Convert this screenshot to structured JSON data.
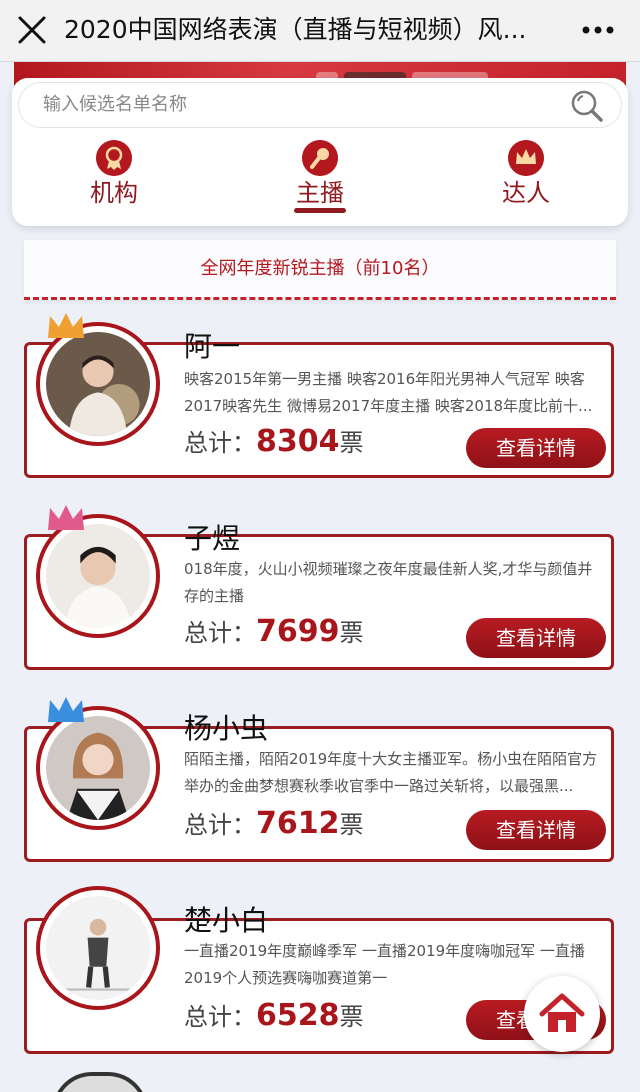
{
  "titlebar": {
    "title": "2020中国网络表演（直播与短视频）风..."
  },
  "search": {
    "placeholder": "输入候选名单名称"
  },
  "tabs": [
    {
      "label": "机构",
      "icon": "medal-icon",
      "active": false
    },
    {
      "label": "主播",
      "icon": "microphone-icon",
      "active": true
    },
    {
      "label": "达人",
      "icon": "crown-icon",
      "active": false
    }
  ],
  "ranking_title": "全网年度新锐主播（前10名）",
  "candidates": [
    {
      "rank": 1,
      "name": "阿一",
      "desc": "映客2015年第一男主播 映客2016年阳光男神人气冠军 映客2017映客先生 微博易2017年度主播 映客2018年度比前十...",
      "total_label": "总计：",
      "votes": "8304",
      "unit": "票",
      "button": "查看详情"
    },
    {
      "rank": 2,
      "name": "子煜",
      "desc": "018年度，火山小视频璀璨之夜年度最佳新人奖,才华与颜值并存的主播",
      "total_label": "总计：",
      "votes": "7699",
      "unit": "票",
      "button": "查看详情"
    },
    {
      "rank": 3,
      "name": "杨小虫",
      "desc": "陌陌主播，陌陌2019年度十大女主播亚军。杨小虫在陌陌官方举办的金曲梦想赛秋季收官季中一路过关斩将，以最强黑...",
      "total_label": "总计：",
      "votes": "7612",
      "unit": "票",
      "button": "查看详情"
    },
    {
      "rank": 4,
      "name": "楚小白",
      "desc": "一直播2019年度巅峰季军 一直播2019年度嗨咖冠军 一直播2019个人预选赛嗨咖赛道第一",
      "total_label": "总计：",
      "votes": "6528",
      "unit": "票",
      "button": "查看详情"
    }
  ],
  "colors": {
    "brand": "#a8151b",
    "background": "#eef0f8",
    "crown_gold": "#f0a030",
    "crown_pink": "#e05a8a",
    "crown_blue": "#3a8ee0"
  }
}
